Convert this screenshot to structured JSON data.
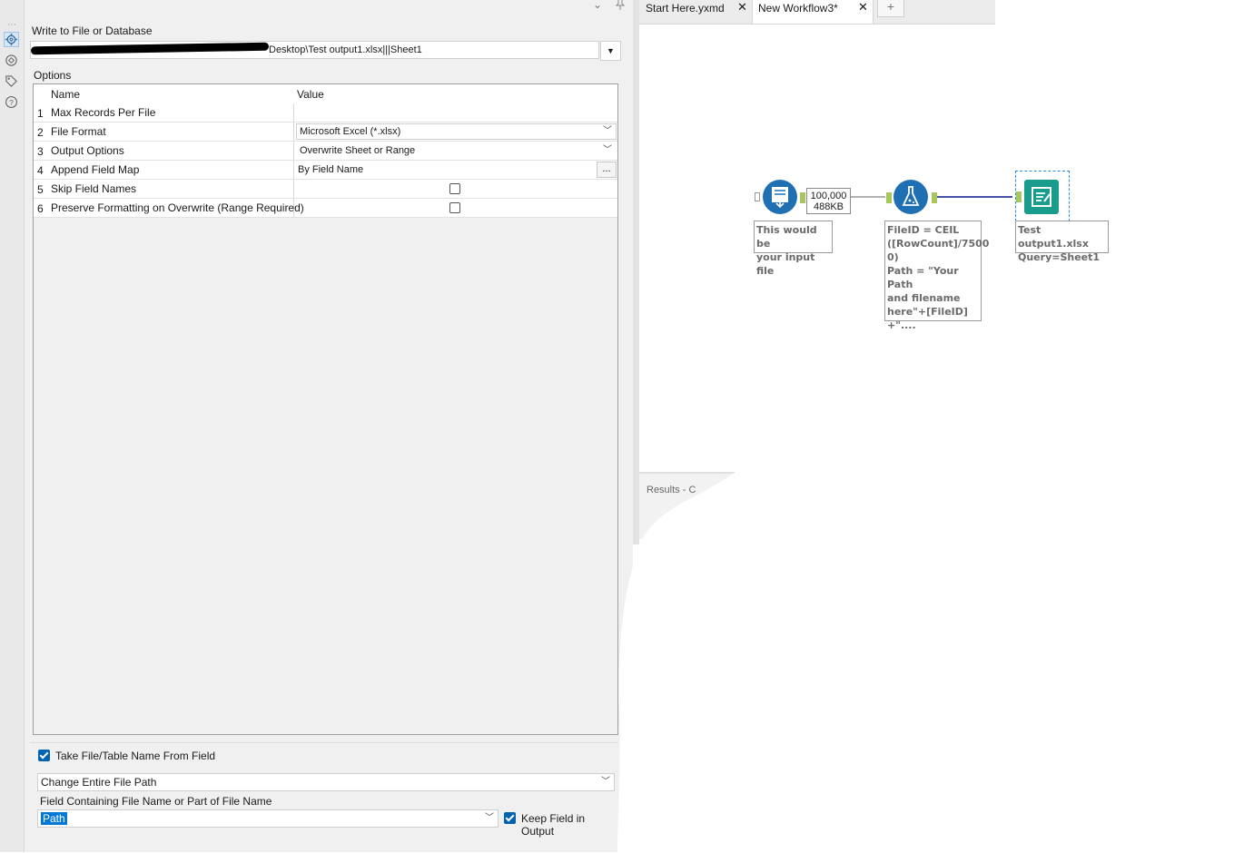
{
  "config": {
    "title": "Write to File or Database",
    "path_value": "Desktop\\Test output1.xlsx|||Sheet1",
    "options_label": "Options",
    "grid": {
      "col_name": "Name",
      "col_value": "Value",
      "rows": [
        {
          "num": "1",
          "name": "Max Records Per File",
          "value": ""
        },
        {
          "num": "2",
          "name": "File Format",
          "value": "Microsoft Excel (*.xlsx)"
        },
        {
          "num": "3",
          "name": "Output Options",
          "value": "Overwrite Sheet or Range"
        },
        {
          "num": "4",
          "name": "Append Field Map",
          "value": "By Field Name",
          "button": "..."
        },
        {
          "num": "5",
          "name": "Skip Field Names",
          "checked": false
        },
        {
          "num": "6",
          "name": "Preserve Formatting on Overwrite (Range Required)",
          "checked": false
        }
      ]
    },
    "take_field": {
      "checkbox_label": "Take File/Table Name From Field",
      "checked": true,
      "mode_value": "Change Entire File Path",
      "field_label": "Field Containing File Name or Part of File Name",
      "field_value": "Path",
      "keep_label": "Keep Field in Output",
      "keep_checked": true
    }
  },
  "tabs": [
    {
      "label": "Start Here.yxmd",
      "active": false
    },
    {
      "label": "New Workflow3*",
      "active": true
    }
  ],
  "workflow": {
    "record_count": "100,000",
    "record_size": "488KB",
    "input_annotation": "This would be\nyour input file",
    "formula_annotation": "FileID = CEIL\n([RowCount]/7500\n0)\nPath = \"Your Path\nand filename\nhere\"+[FileID]\n+\"....",
    "output_annotation": "Test output1.xlsx\nQuery=Sheet1"
  },
  "results_label": "Results - C",
  "colors": {
    "input_tool": "#1f6fb3",
    "formula_tool": "#1f6fb3",
    "output_tool": "#1a9c8c",
    "connection": "#2b3a9c",
    "anchor": "#a7c65c"
  }
}
